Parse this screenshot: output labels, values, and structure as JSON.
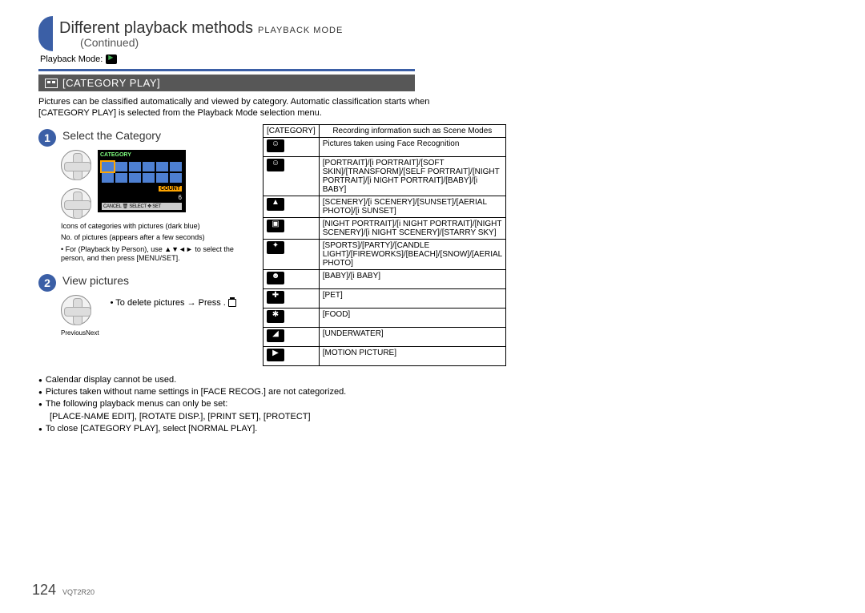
{
  "header": {
    "title": "Different playback methods",
    "mode_tag": "PLAYBACK MODE",
    "continued": "(Continued)",
    "playback_mode_label": "Playback Mode:"
  },
  "section": {
    "title": "[CATEGORY PLAY]"
  },
  "intro": "Pictures can be classified automatically and viewed by category. Automatic classification starts when [CATEGORY PLAY] is selected from the Playback Mode selection menu.",
  "steps": {
    "s1": {
      "num": "1",
      "title": "Select the Category",
      "note_icons": "Icons of categories with pictures (dark blue)",
      "note_count": "No. of pictures (appears after a few seconds)",
      "note_playback": "For      (Playback by Person), use ▲▼◄► to select the person, and then press [MENU/SET].",
      "thumb_label": "CATEGORY",
      "thumb_count_label": "COUNT",
      "thumb_count_value": "6",
      "thumb_bottom": "CANCEL 🗑  SELECT ✥  SET"
    },
    "s2": {
      "num": "2",
      "title": "View pictures",
      "prev": "Previous",
      "next": "Next",
      "delete_note": "To delete pictures → Press     ."
    }
  },
  "table": {
    "h1": "[CATEGORY]",
    "h2": "Recording information such as Scene Modes",
    "rows": [
      {
        "icon": "face",
        "text": "Pictures taken using Face Recognition"
      },
      {
        "icon": "port",
        "text": "[PORTRAIT]/[i PORTRAIT]/[SOFT SKIN]/[TRANSFORM]/[SELF PORTRAIT]/[NIGHT PORTRAIT]/[i NIGHT PORTRAIT]/[BABY]/[i BABY]"
      },
      {
        "icon": "scen",
        "text": "[SCENERY]/[i SCENERY]/[SUNSET]/[AERIAL PHOTO]/[i SUNSET]"
      },
      {
        "icon": "night",
        "text": "[NIGHT PORTRAIT]/[i NIGHT PORTRAIT]/[NIGHT SCENERY]/[i NIGHT SCENERY]/[STARRY SKY]"
      },
      {
        "icon": "sport",
        "text": "[SPORTS]/[PARTY]/[CANDLE LIGHT]/[FIREWORKS]/[BEACH]/[SNOW]/[AERIAL PHOTO]"
      },
      {
        "icon": "baby",
        "text": "[BABY]/[i BABY]"
      },
      {
        "icon": "pet",
        "text": "[PET]"
      },
      {
        "icon": "food",
        "text": "[FOOD]"
      },
      {
        "icon": "under",
        "text": "[UNDERWATER]"
      },
      {
        "icon": "motion",
        "text": "[MOTION PICTURE]"
      }
    ]
  },
  "bullets": {
    "b1": "Calendar display cannot be used.",
    "b2": "Pictures taken without name settings in [FACE RECOG.] are not categorized.",
    "b3": "The following playback menus can only be set:",
    "b3a": "[PLACE-NAME EDIT], [ROTATE DISP.], [PRINT SET], [PROTECT]",
    "b4": "To close [CATEGORY PLAY], select [NORMAL PLAY]."
  },
  "footer": {
    "page": "124",
    "code": "VQT2R20"
  }
}
